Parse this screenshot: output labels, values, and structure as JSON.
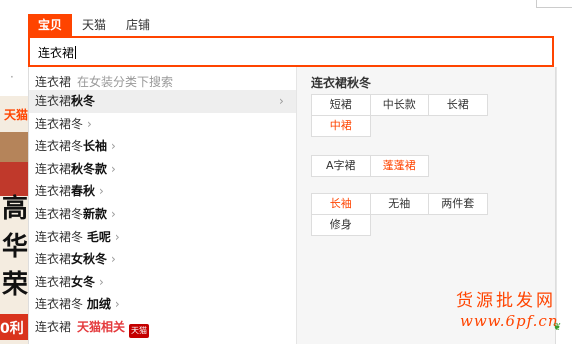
{
  "tabs": [
    "宝贝",
    "天猫",
    "店铺"
  ],
  "search": {
    "value": "连衣裙"
  },
  "background": {
    "tmall_text": "天猫",
    "big_chars": [
      "高",
      "华",
      "荣"
    ],
    "badge_text": "0利"
  },
  "suggestions": {
    "head_query": "连衣裙",
    "head_hint": "在女装分类下搜索",
    "items": [
      {
        "base": "连衣裙",
        "bold": "秋冬",
        "has_arrow": true,
        "active": true
      },
      {
        "base": "连衣裙冬",
        "bold": "",
        "has_arrow": true,
        "active": false
      },
      {
        "base": "连衣裙冬",
        "bold": "长袖",
        "has_arrow": true,
        "active": false
      },
      {
        "base": "连衣裙",
        "bold": "秋冬款",
        "has_arrow": true,
        "active": false
      },
      {
        "base": "连衣裙",
        "bold": "春秋",
        "has_arrow": true,
        "active": false
      },
      {
        "base": "连衣裙冬",
        "bold": "新款",
        "has_arrow": true,
        "active": false
      },
      {
        "base": "连衣裙冬 ",
        "bold": "毛呢",
        "has_arrow": true,
        "active": false
      },
      {
        "base": "连衣裙",
        "bold": "女秋冬",
        "has_arrow": true,
        "active": false
      },
      {
        "base": "连衣裙",
        "bold": "女冬",
        "has_arrow": true,
        "active": false
      },
      {
        "base": "连衣裙冬 ",
        "bold": "加绒",
        "has_arrow": true,
        "active": false
      }
    ],
    "tmall_item": {
      "base": "连衣裙",
      "red": "天猫相关",
      "badge": "天猫"
    },
    "arrow_glyph": "›"
  },
  "properties": {
    "title": "连衣裙秋冬",
    "groups": [
      [
        {
          "label": "短裙",
          "hl": false
        },
        {
          "label": "中长款",
          "hl": false
        },
        {
          "label": "长裙",
          "hl": false
        },
        {
          "label": "中裙",
          "hl": true
        }
      ],
      [
        {
          "label": "A字裙",
          "hl": false
        },
        {
          "label": "蓬蓬裙",
          "hl": true
        }
      ],
      [
        {
          "label": "长袖",
          "hl": true
        },
        {
          "label": "无袖",
          "hl": false
        },
        {
          "label": "两件套",
          "hl": false
        },
        {
          "label": "修身",
          "hl": false
        }
      ]
    ]
  },
  "watermark": {
    "line1": "货源批发网",
    "line2": "www.6pf.cn"
  },
  "colors": {
    "accent": "#ff4400",
    "tmall_red": "#c40000"
  }
}
